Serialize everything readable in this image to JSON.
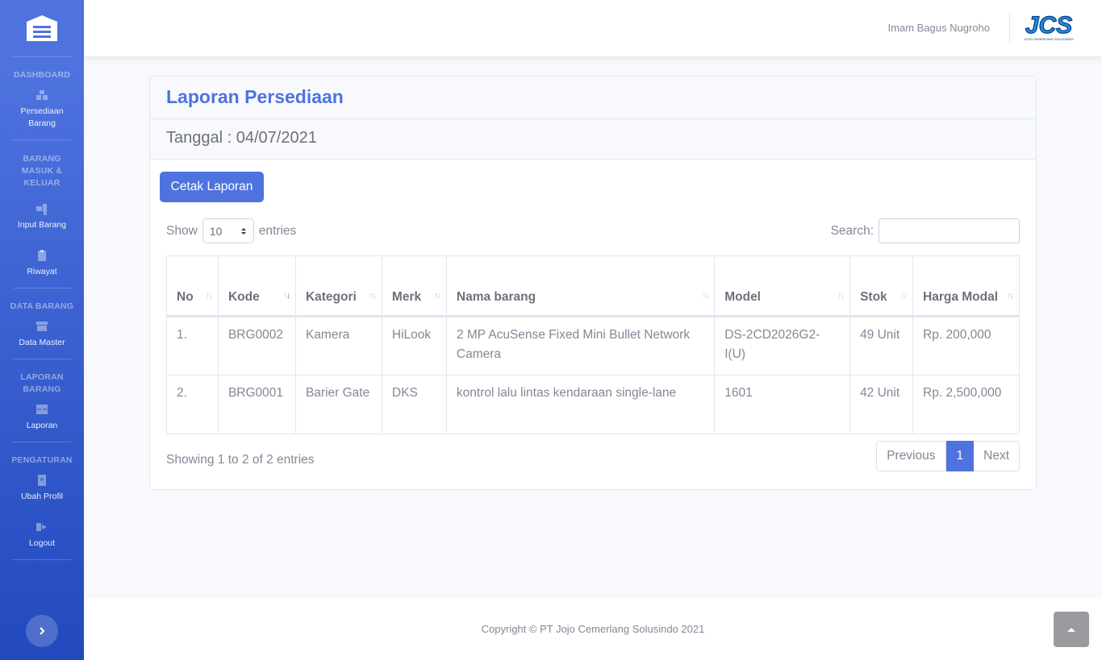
{
  "sidebar": {
    "brand_icon": "warehouse-icon",
    "sections": [
      {
        "heading": "DASHBOARD",
        "items": [
          {
            "label": "Persediaan Barang",
            "icon": "boxes-icon"
          }
        ]
      },
      {
        "heading": "BARANG MASUK & KELUAR",
        "items": [
          {
            "label": "Input Barang",
            "icon": "truck-loading-icon"
          },
          {
            "label": "Riwayat",
            "icon": "clipboard-icon"
          }
        ]
      },
      {
        "heading": "DATA BARANG",
        "items": [
          {
            "label": "Data Master",
            "icon": "archive-icon"
          }
        ]
      },
      {
        "heading": "LAPORAN BARANG",
        "items": [
          {
            "label": "Laporan",
            "icon": "table-icon"
          }
        ]
      },
      {
        "heading": "PENGATURAN",
        "items": [
          {
            "label": "Ubah Profil",
            "icon": "id-badge-icon"
          },
          {
            "label": "Logout",
            "icon": "sign-out-icon"
          }
        ]
      }
    ],
    "toggle_icon": "chevron-right-icon"
  },
  "topbar": {
    "username": "Imam Bagus Nugroho",
    "logo_text": "JCS",
    "logo_subtext": "JOJO CEMERLANG SOLUSINDO"
  },
  "card": {
    "title": "Laporan Persediaan",
    "date_label": "Tanggal : 04/07/2021",
    "print_button": "Cetak Laporan"
  },
  "table_controls": {
    "show_label": "Show",
    "entries_label": "entries",
    "page_length": "10",
    "search_label": "Search:",
    "search_value": ""
  },
  "table": {
    "columns": [
      "No",
      "Kode",
      "Kategori",
      "Merk",
      "Nama barang",
      "Model",
      "Stok",
      "Harga Modal"
    ],
    "sorted_column": "Kode",
    "rows": [
      [
        "1.",
        "BRG0002",
        "Kamera",
        "HiLook",
        "2 MP AcuSense Fixed Mini Bullet Network Camera",
        "DS-2CD2026G2-I(U)",
        "49 Unit",
        "Rp. 200,000"
      ],
      [
        "2.",
        "BRG0001",
        "Barier Gate",
        "DKS",
        "kontrol lalu lintas kendaraan single-lane",
        "1601",
        "42 Unit",
        "Rp. 2,500,000"
      ]
    ]
  },
  "pagination": {
    "info": "Showing 1 to 2 of 2 entries",
    "previous": "Previous",
    "current": "1",
    "next": "Next"
  },
  "footer": {
    "copyright": "Copyright © PT Jojo Cemerlang Solusindo 2021"
  },
  "colors": {
    "primary": "#4e73df",
    "sidebar_gradient_end": "#224abe",
    "background": "#f8f9fc",
    "text": "#858796"
  }
}
